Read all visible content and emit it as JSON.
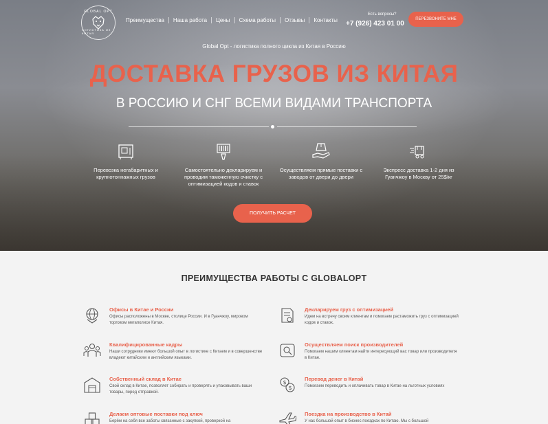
{
  "logo": {
    "top": "GLOBAL OPT",
    "bottom": "ЛОГИСТИКА ИЗ КИТАЯ"
  },
  "nav": [
    "Преимущества",
    "Наша работа",
    "Цены",
    "Схема работы",
    "Отзывы",
    "Контакты"
  ],
  "contact": {
    "question": "Есть вопросы?",
    "phone": "+7 (926) 423 01 00",
    "callback_button": "ПЕРЕЗВОНИТЕ МНЕ"
  },
  "hero": {
    "tagline": "Global Opt - логистика полного цикла из Китая в Россию",
    "headline": "ДОСТАВКА ГРУЗОВ ИЗ КИТАЯ",
    "subheadline": "В РОССИЮ И СНГ ВСЕМИ ВИДАМИ ТРАНСПОРТА",
    "features": [
      {
        "icon": "safe-box-icon",
        "text": "Перевозка негабаритных и крупнотоннажных грузов"
      },
      {
        "icon": "barcode-scanner-icon",
        "text": "Самостоятельно декларируем и проводим таможенную очистку с оптимизацией кодов и ставок"
      },
      {
        "icon": "box-on-hand-icon",
        "text": "Осуществляем прямые поставки с заводов от двери до двери"
      },
      {
        "icon": "fast-truck-icon",
        "text": "Экспресс доставка 1-2 дня из Гуанчжоу в Москву от 25$/кг"
      }
    ],
    "cta": "ПОЛУЧИТЬ РАСЧЕТ"
  },
  "advantages": {
    "title": "ПРЕИМУЩЕСТВА РАБОТЫ С GLOBALOPT",
    "items": [
      {
        "icon": "globe-pin-icon",
        "title": "Офисы в Китае и России",
        "desc": "Офисы расположены в Москве, столице России. И в Гуанчжоу, мировом торговом мегаполисе Китая."
      },
      {
        "icon": "declaration-icon",
        "title": "Декларируем груз с оптимизацией",
        "desc": "Идем на встречу своим клиентам и помогаем растаможить груз с оптимизацией кодов и ставок."
      },
      {
        "icon": "team-icon",
        "title": "Квалифицированные кадры",
        "desc": "Наши сотрудники имеют большой опыт в логистике с Китаем и в совершенстве владеют китайским и английским языками."
      },
      {
        "icon": "search-supplier-icon",
        "title": "Осуществляем поиск производителей",
        "desc": "Помогаем нашим клиентам найти интересующий вас товар или производителя в Китае."
      },
      {
        "icon": "warehouse-icon",
        "title": "Собственный склад в Китае",
        "desc": "Свой склад в Китае, позволяет собирать и проверять и упаковывать ваши товары, перед отправкой."
      },
      {
        "icon": "money-transfer-icon",
        "title": "Перевод денег в Китай",
        "desc": "Помогаем переводить и оплачивать товар в Китае на льготных условиях"
      },
      {
        "icon": "boxes-icon",
        "title": "Делаем оптовые поставки под ключ",
        "desc": "Берём на себя все заботы связанные с закупкой, проверкой на"
      },
      {
        "icon": "airplane-icon",
        "title": "Поездка на производство в Китай",
        "desc": "У нас большой опыт в бизнес поездках по Китаю. Мы с большой"
      }
    ]
  },
  "colors": {
    "accent": "#e8624c",
    "text_dark": "#333333",
    "section_bg": "#f3f3f3"
  }
}
